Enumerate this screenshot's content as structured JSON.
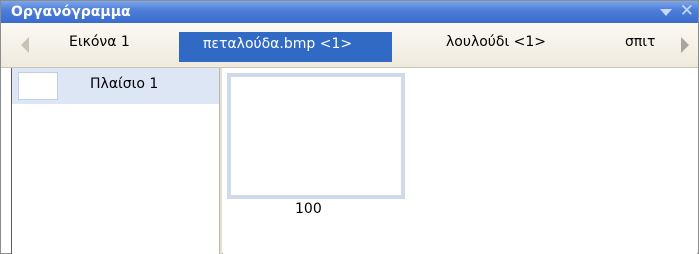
{
  "panel": {
    "title": "Οργανόγραμμα",
    "menu_icon": "chevron-down-icon",
    "close_icon": "close-icon"
  },
  "tabs": [
    {
      "label": "Εικόνα 1",
      "active": false
    },
    {
      "label": "πεταλούδα.bmp <1>",
      "active": true
    },
    {
      "label": "λουλούδι <1>",
      "active": false
    },
    {
      "label": "σπιτ",
      "active": false
    }
  ],
  "frames": {
    "items": [
      {
        "label": "Πλαίσιο 1",
        "selected": true
      }
    ]
  },
  "thumbnails": [
    {
      "label": "100"
    }
  ],
  "colors": {
    "titlebar": "#3b6bcf",
    "tab_active": "#316ac5",
    "frame_selected": "#dde6f5",
    "thumb_border": "#cfdaea"
  }
}
